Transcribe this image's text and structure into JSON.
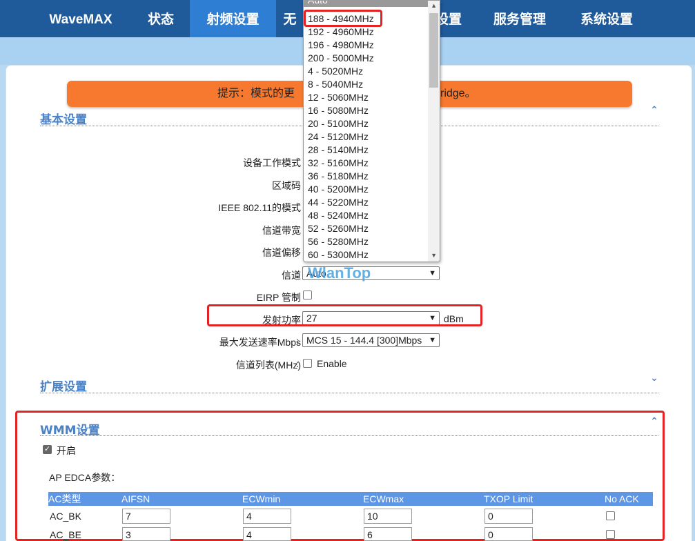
{
  "nav": {
    "brand": "WaveMAX",
    "items": [
      "状态",
      "射频设置",
      "无",
      "设置",
      "服务管理",
      "系统设置"
    ]
  },
  "tip": {
    "text": "提示：模式的更",
    "text_tail": "ridge。"
  },
  "basic": {
    "title": "基本设置",
    "labels": {
      "mode": "设备工作模式",
      "region": "区域码",
      "ieee": "IEEE 802.11的模式",
      "bandwidth": "信道带宽",
      "offset": "信道偏移",
      "channel": "信道",
      "eirp": "EIRP 管制",
      "power": "发射功率",
      "rate": "最大发送速率Mbps",
      "chanlist": "信道列表(MHz)"
    },
    "power_value": "27",
    "power_unit": "dBm",
    "rate_value": "MCS 15 - 144.4 [300]Mbps",
    "channel_value": "Auto",
    "chanlist_enable": "Enable"
  },
  "ext": {
    "title": "扩展设置"
  },
  "wmm": {
    "title": "WMM设置",
    "enable_label": "开启",
    "edca_label": "AP EDCA参数：",
    "headers": [
      "AC类型",
      "AIFSN",
      "ECWmin",
      "ECWmax",
      "TXOP Limit",
      "No ACK"
    ],
    "rows": [
      {
        "type": "AC_BK",
        "aifsn": "7",
        "ecwmin": "4",
        "ecwmax": "10",
        "txop": "0"
      },
      {
        "type": "AC_BE",
        "aifsn": "3",
        "ecwmin": "4",
        "ecwmax": "6",
        "txop": "0"
      }
    ]
  },
  "dropdown": {
    "options": [
      "Auto",
      "188 - 4940MHz",
      "192 - 4960MHz",
      "196 - 4980MHz",
      "200 - 5000MHz",
      "4 - 5020MHz",
      "8 - 5040MHz",
      "12 - 5060MHz",
      "16 - 5080MHz",
      "20 - 5100MHz",
      "24 - 5120MHz",
      "28 - 5140MHz",
      "32 - 5160MHz",
      "36 - 5180MHz",
      "40 - 5200MHz",
      "44 - 5220MHz",
      "48 - 5240MHz",
      "52 - 5260MHz",
      "56 - 5280MHz",
      "60 - 5300MHz"
    ]
  },
  "watermark": "WlanTop",
  "colors": {
    "nav_bg": "#1f5a9a",
    "nav_active": "#2e7fd3",
    "tip_bg": "#f7792f",
    "section": "#4a82c8",
    "highlight": "#e52222"
  }
}
